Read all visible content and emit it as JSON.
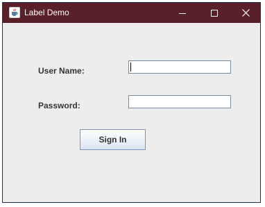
{
  "window": {
    "title": "Label Demo",
    "app_icon": "java-cup-icon",
    "controls": {
      "minimize_icon": "minimize-icon",
      "maximize_icon": "maximize-icon",
      "close_icon": "close-icon"
    },
    "colors": {
      "titlebar": "#5a2029",
      "client_background": "#eeeded"
    }
  },
  "form": {
    "username_label": "User Name:",
    "username_value": "",
    "password_label": "Password:",
    "password_value": "",
    "signin_label": "Sign In"
  }
}
